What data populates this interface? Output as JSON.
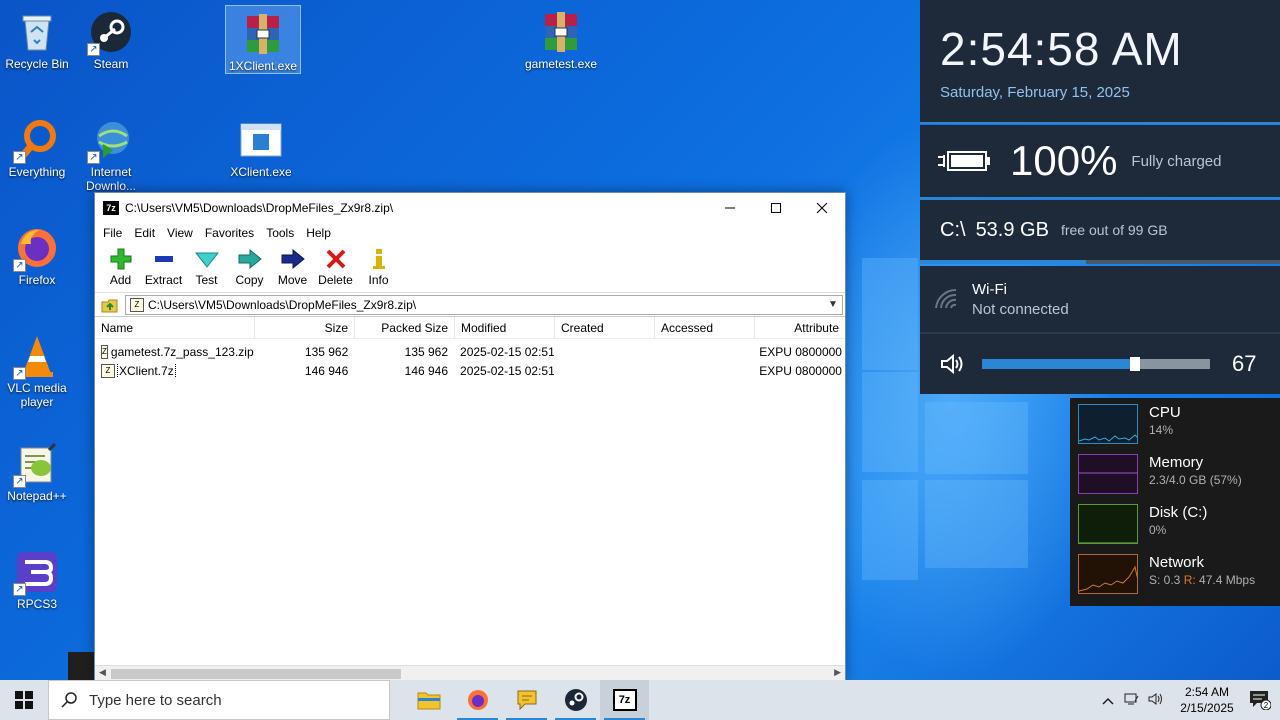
{
  "desktop": {
    "icons": [
      {
        "label": "Recycle Bin"
      },
      {
        "label": "Steam"
      },
      {
        "label": "1XClient.exe"
      },
      {
        "label": "gametest.exe"
      },
      {
        "label": "Everything"
      },
      {
        "label": "Internet Downlo..."
      },
      {
        "label": "XClient.exe"
      },
      {
        "label": "Firefox"
      },
      {
        "label": "VLC media player"
      },
      {
        "label": "Notepad++"
      },
      {
        "label": "RPCS3"
      }
    ]
  },
  "window": {
    "title": "C:\\Users\\VM5\\Downloads\\DropMeFiles_Zx9r8.zip\\",
    "app_icon_text": "7z",
    "menu": [
      "File",
      "Edit",
      "View",
      "Favorites",
      "Tools",
      "Help"
    ],
    "toolbar": [
      "Add",
      "Extract",
      "Test",
      "Copy",
      "Move",
      "Delete",
      "Info"
    ],
    "address": "C:\\Users\\VM5\\Downloads\\DropMeFiles_Zx9r8.zip\\",
    "columns": [
      "Name",
      "Size",
      "Packed Size",
      "Modified",
      "Created",
      "Accessed",
      "Attribute"
    ],
    "rows": [
      {
        "name": "gametest.7z_pass_123.zip",
        "size": "135 962",
        "packed": "135 962",
        "modified": "2025-02-15 02:51",
        "created": "",
        "accessed": "",
        "attr": "EXPU 0800000"
      },
      {
        "name": "XClient.7z",
        "size": "146 946",
        "packed": "146 946",
        "modified": "2025-02-15 02:51",
        "created": "",
        "accessed": "",
        "attr": "EXPU 0800000"
      }
    ]
  },
  "gadgets": {
    "time": "2:54:58 AM",
    "date": "Saturday, February 15, 2025",
    "battery_percent": "100%",
    "battery_status": "Fully charged",
    "drive": "C:\\",
    "drive_free": "53.9 GB",
    "drive_total": "free out of 99 GB",
    "drive_used_fraction": 0.46,
    "wifi_name": "Wi-Fi",
    "wifi_status": "Not connected",
    "volume": "67",
    "volume_fraction": 0.67
  },
  "resources": [
    {
      "name": "CPU",
      "value": "14%",
      "color": "#2e8bc0"
    },
    {
      "name": "Memory",
      "value": "2.3/4.0 GB (57%)",
      "color": "#8b3fa8"
    },
    {
      "name": "Disk (C:)",
      "value": "0%",
      "color": "#5a9c2e"
    },
    {
      "name": "Network",
      "value_s": "S: 0.3",
      "value_r": "R:",
      "value_rest": "47.4 Mbps",
      "color": "#b06a2a"
    }
  ],
  "taskbar": {
    "search_placeholder": "Type here to search",
    "time": "2:54 AM",
    "date": "2/15/2025",
    "notification_count": "2"
  }
}
